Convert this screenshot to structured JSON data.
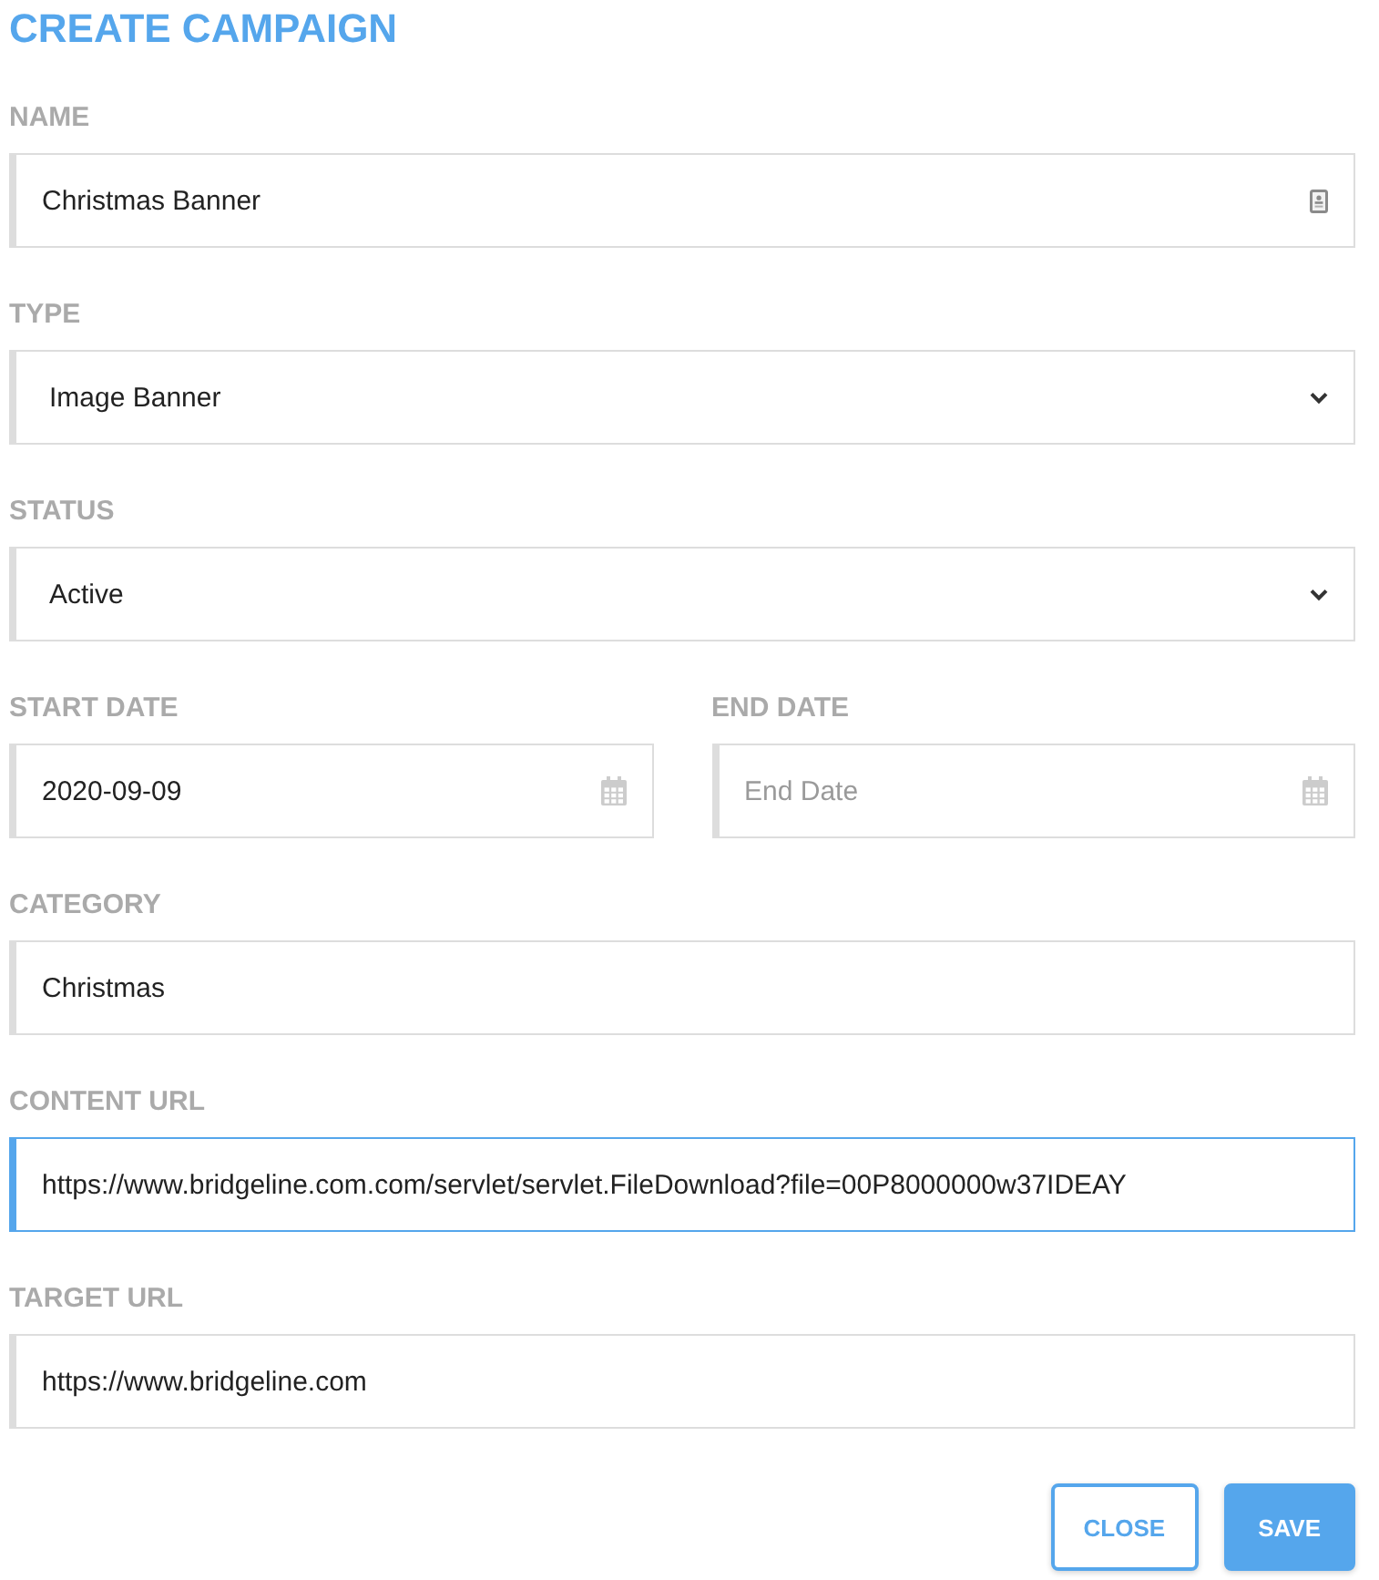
{
  "title": "CREATE CAMPAIGN",
  "rows": [
    {
      "fields": [
        {
          "label": "NAME",
          "kind": "autofill",
          "value": "Christmas Banner",
          "focused": false
        }
      ]
    },
    {
      "fields": [
        {
          "label": "TYPE",
          "kind": "select",
          "value": "Image Banner",
          "focused": false
        }
      ]
    },
    {
      "fields": [
        {
          "label": "STATUS",
          "kind": "select",
          "value": "Active",
          "focused": false
        }
      ]
    },
    {
      "fields": [
        {
          "label": "START DATE",
          "kind": "date",
          "value": "2020-09-09",
          "focused": false
        },
        {
          "label": "END DATE",
          "kind": "date",
          "placeholder": "End Date",
          "focused": false
        }
      ]
    },
    {
      "fields": [
        {
          "label": "CATEGORY",
          "kind": "text",
          "value": "Christmas",
          "focused": false
        }
      ]
    },
    {
      "fields": [
        {
          "label": "CONTENT URL",
          "kind": "text",
          "value": "https://www.bridgeline.com.com/servlet/servlet.FileDownload?file=00P8000000w37IDEAY",
          "focused": true
        }
      ]
    },
    {
      "fields": [
        {
          "label": "TARGET URL",
          "kind": "text",
          "value": "https://www.bridgeline.com",
          "focused": false
        }
      ]
    }
  ],
  "buttons": [
    {
      "label": "CLOSE",
      "kind": "outline"
    },
    {
      "label": "SAVE",
      "kind": "primary"
    }
  ]
}
